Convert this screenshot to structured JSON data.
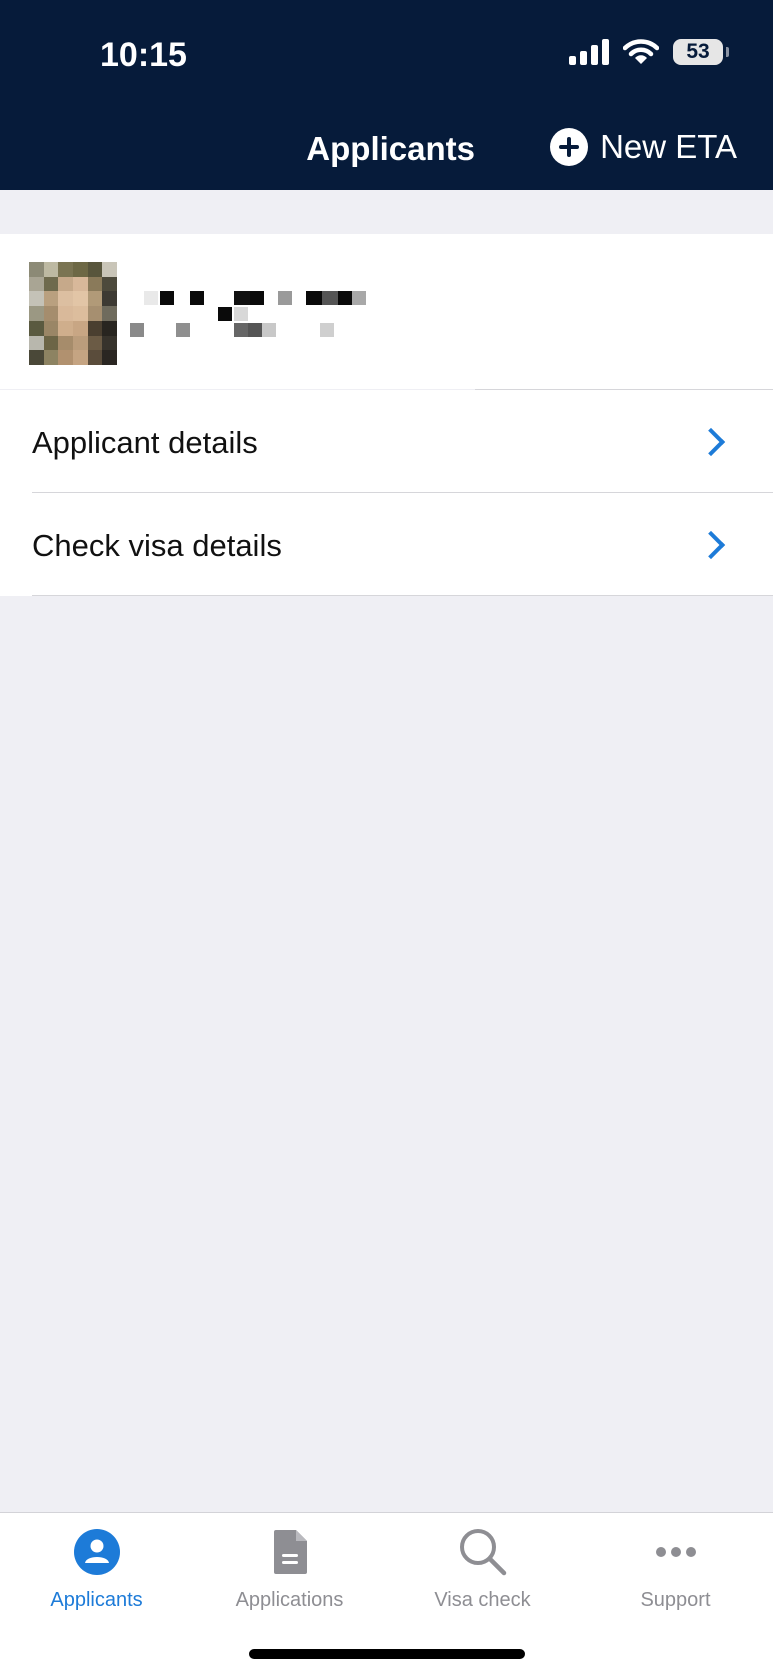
{
  "status_bar": {
    "time": "10:15",
    "battery": "53"
  },
  "nav": {
    "title": "Applicants",
    "new_eta_label": "New ETA"
  },
  "menu": [
    {
      "label": "Applicant details"
    },
    {
      "label": "Check visa details"
    }
  ],
  "tabs": [
    {
      "label": "Applicants",
      "icon": "person-icon",
      "active": true
    },
    {
      "label": "Applications",
      "icon": "document-icon",
      "active": false
    },
    {
      "label": "Visa check",
      "icon": "search-icon",
      "active": false
    },
    {
      "label": "Support",
      "icon": "more-icon",
      "active": false
    }
  ],
  "colors": {
    "header": "#061b3a",
    "accent": "#1d7bd8",
    "background": "#efeff4"
  }
}
